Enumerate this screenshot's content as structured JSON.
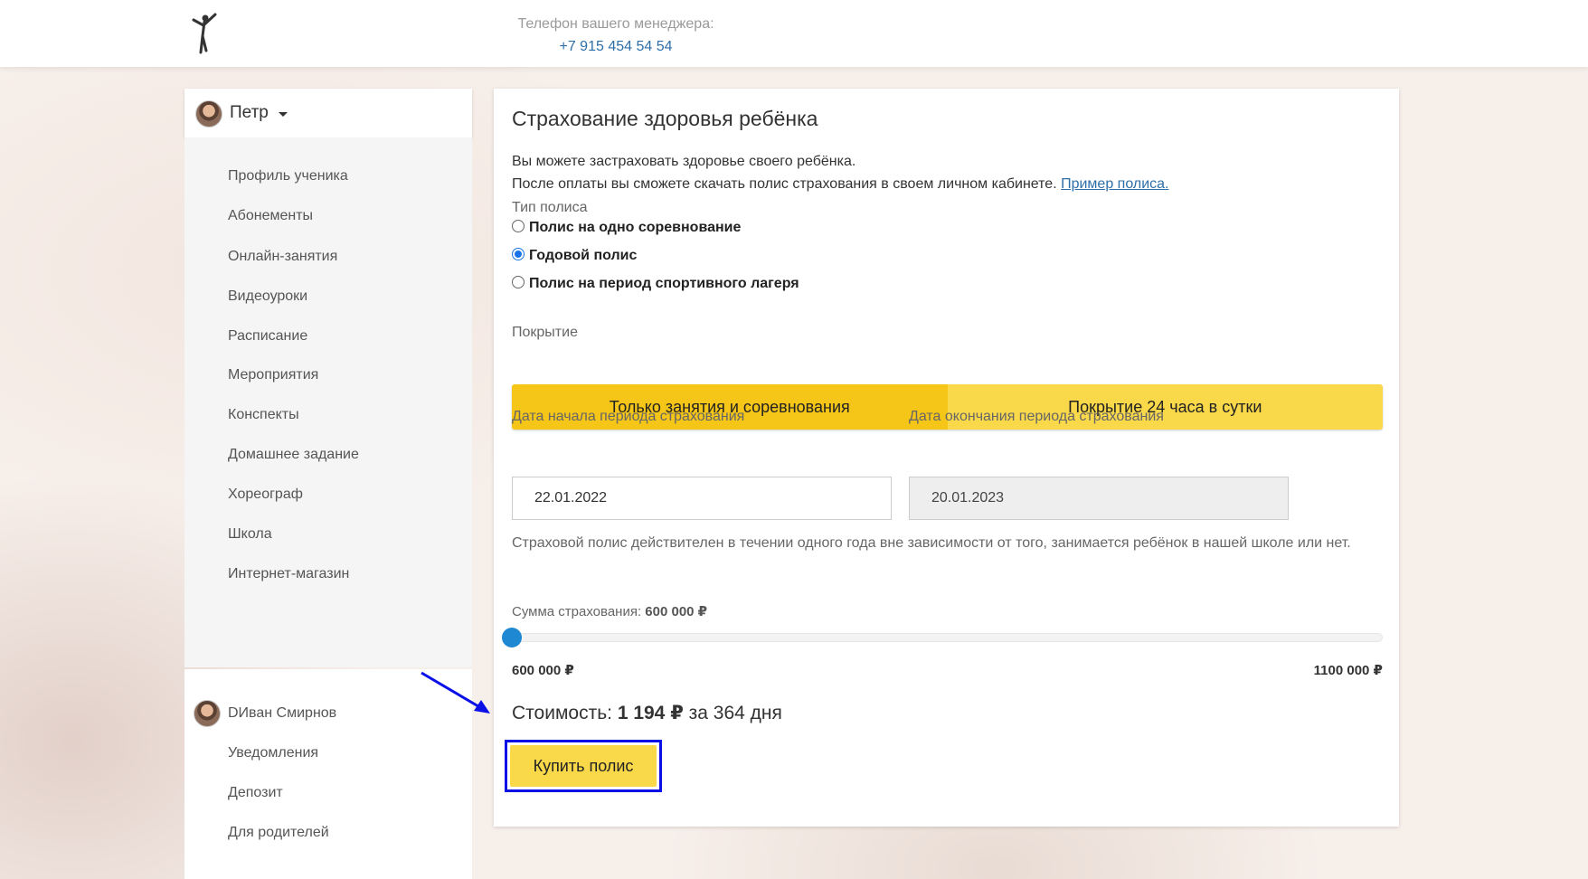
{
  "header": {
    "manager_label": "Телефон вашего менеджера:",
    "manager_phone": "+7 915 454 54 54"
  },
  "user": {
    "name": "Петр"
  },
  "sidebar": {
    "items": [
      "Профиль ученика",
      "Абонементы",
      "Онлайн-занятия",
      "Видеоуроки",
      "Расписание",
      "Мероприятия",
      "Конспекты",
      "Домашнее задание",
      "Хореограф",
      "Школа",
      "Интернет-магазин"
    ],
    "account": {
      "name": "DИван Смирнов",
      "items": [
        "Уведомления",
        "Депозит",
        "Для родителей"
      ]
    }
  },
  "insurance": {
    "title": "Страхование здоровья ребёнка",
    "desc_line1": "Вы можете застраховать здоровье своего ребёнка.",
    "desc_line2": "После оплаты вы сможете скачать полис страхования в своем личном кабинете.",
    "sample_link": "Пример полиса.",
    "policy_type_label": "Тип полиса",
    "policy_types": [
      "Полис на одно соревнование",
      "Годовой полис",
      "Полис на период спортивного лагеря"
    ],
    "selected_policy_index": 1,
    "coverage_label": "Покрытие",
    "coverage_options": [
      "Только занятия и соревнования",
      "Покрытие 24 часа в сутки"
    ],
    "selected_coverage_index": 0,
    "start_date_label": "Дата начала периода страхования",
    "start_date": "22.01.2022",
    "end_date_label": "Дата окончания периода страхования",
    "end_date": "20.01.2023",
    "note": "Страховой полис действителен в течении одного года вне зависимости от того, занимается ребёнок в нашей школе или нет.",
    "sum_label": "Сумма страхования:",
    "sum_value": "600 000 ₽",
    "slider_min_label": "600 000 ₽",
    "slider_max_label": "1100 000 ₽",
    "slider_fraction": 0,
    "cost_label": "Стоимость:",
    "cost_value": "1 194 ₽",
    "cost_period": "за 364 дня",
    "buy_button": "Купить полис"
  },
  "colors": {
    "accent_yellow": "#f5c518",
    "button_yellow": "#f9d84a",
    "link_blue": "#2f6fa8",
    "highlight_blue": "#0a10e6",
    "slider_blue": "#1e88d2"
  }
}
